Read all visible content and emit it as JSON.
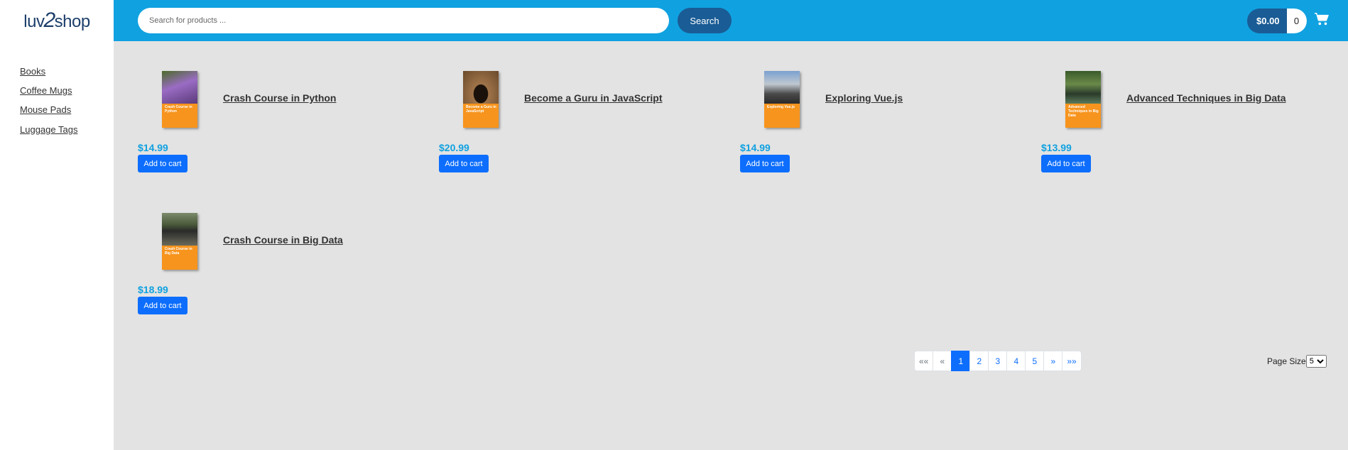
{
  "header": {
    "logo_text_left": "luv",
    "logo_text_mid": "2",
    "logo_text_right": "shop",
    "search_placeholder": "Search for products ...",
    "search_button": "Search",
    "cart_total": "$0.00",
    "cart_quantity": "0"
  },
  "sidebar": {
    "items": [
      {
        "label": "Books"
      },
      {
        "label": "Coffee Mugs"
      },
      {
        "label": "Mouse Pads"
      },
      {
        "label": "Luggage Tags"
      }
    ]
  },
  "products": [
    {
      "name": "Crash Course in Python",
      "price": "$14.99",
      "cover_title": "Crash Course in Python",
      "cover_color": "#8a6fb0"
    },
    {
      "name": "Become a Guru in JavaScript",
      "price": "$20.99",
      "cover_title": "Become a Guru in JavaScript",
      "cover_color": "#7a5a3a"
    },
    {
      "name": "Exploring Vue.js",
      "price": "$14.99",
      "cover_title": "Exploring Vue.js",
      "cover_color": "#5a6a80"
    },
    {
      "name": "Advanced Techniques in Big Data",
      "price": "$13.99",
      "cover_title": "Advanced Techniques in Big Data",
      "cover_color": "#4a6a3a"
    },
    {
      "name": "Crash Course in Big Data",
      "price": "$18.99",
      "cover_title": "Crash Course in Big Data",
      "cover_color": "#556b4a"
    }
  ],
  "add_to_cart_label": "Add to cart",
  "pagination": {
    "items": [
      "««",
      "«",
      "1",
      "2",
      "3",
      "4",
      "5",
      "»",
      "»»"
    ],
    "active": "1"
  },
  "page_size": {
    "label": "Page Size",
    "selected": "5"
  },
  "colors": {
    "header_bg": "#10a1e0",
    "accent_dark": "#1a5c95",
    "price": "#10a1e0",
    "button": "#0d6efd",
    "content_bg": "#e3e3e3"
  }
}
